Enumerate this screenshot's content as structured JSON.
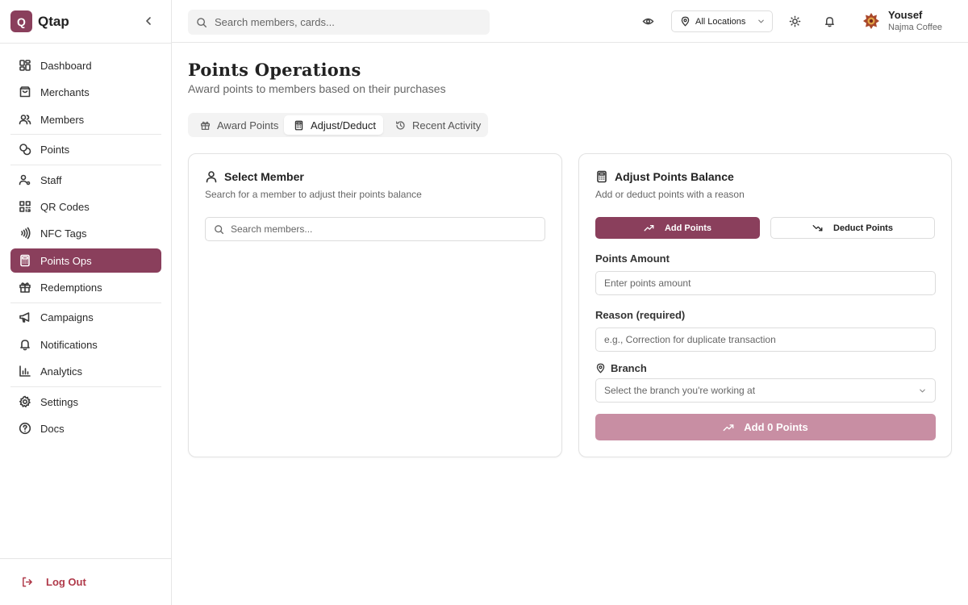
{
  "brand": {
    "logo_letter": "Q",
    "name": "Qtap"
  },
  "sidebar": {
    "items": [
      {
        "label": "Dashboard",
        "icon": "dashboard-icon"
      },
      {
        "label": "Merchants",
        "icon": "store-icon"
      },
      {
        "label": "Members",
        "icon": "users-icon"
      },
      {
        "label": "Points",
        "icon": "coins-icon"
      },
      {
        "label": "Staff",
        "icon": "staff-icon"
      },
      {
        "label": "QR Codes",
        "icon": "qr-code-icon"
      },
      {
        "label": "NFC Tags",
        "icon": "nfc-icon"
      },
      {
        "label": "Points Ops",
        "icon": "calculator-icon",
        "active": true
      },
      {
        "label": "Redemptions",
        "icon": "gift-icon"
      },
      {
        "label": "Campaigns",
        "icon": "megaphone-icon"
      },
      {
        "label": "Notifications",
        "icon": "bell-icon"
      },
      {
        "label": "Analytics",
        "icon": "bar-chart-icon"
      },
      {
        "label": "Settings",
        "icon": "gear-icon"
      },
      {
        "label": "Docs",
        "icon": "help-circle-icon"
      }
    ],
    "logout_label": "Log Out"
  },
  "header": {
    "search_placeholder": "Search members, cards...",
    "location_label": "All Locations",
    "user_name": "Yousef",
    "user_org": "Najma Coffee"
  },
  "page": {
    "title": "Points Operations",
    "subtitle": "Award points to members based on their purchases"
  },
  "tabs": [
    {
      "label": "Award Points",
      "icon": "gift-icon"
    },
    {
      "label": "Adjust/Deduct",
      "icon": "calculator-icon",
      "active": true
    },
    {
      "label": "Recent Activity",
      "icon": "history-icon"
    }
  ],
  "select_member": {
    "title": "Select Member",
    "subtitle": "Search for a member to adjust their points balance",
    "search_placeholder": "Search members..."
  },
  "adjust": {
    "title": "Adjust Points Balance",
    "subtitle": "Add or deduct points with a reason",
    "add_label": "Add Points",
    "deduct_label": "Deduct Points",
    "amount_label": "Points Amount",
    "amount_placeholder": "Enter points amount",
    "reason_label": "Reason (required)",
    "reason_placeholder": "e.g., Correction for duplicate transaction",
    "branch_label": "Branch",
    "branch_placeholder": "Select the branch you're working at",
    "submit_label": "Add 0 Points"
  },
  "colors": {
    "accent": "#8a3f5c",
    "accent_disabled": "#c88ea3",
    "logout": "#b03a4a"
  }
}
